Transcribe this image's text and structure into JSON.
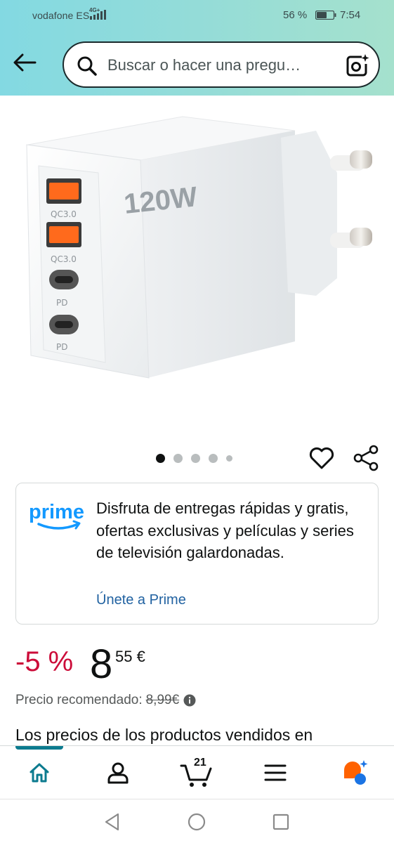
{
  "status_bar": {
    "carrier": "vodafone ES",
    "network_type": "4G+",
    "battery_percent": "56 %",
    "time": "7:54"
  },
  "search": {
    "placeholder": "Buscar o hacer una pregu…",
    "icon": "search-icon",
    "camera_icon": "camera-lens-icon"
  },
  "product": {
    "image_label": "120W",
    "port_labels": [
      "QC3.0",
      "QC3.0",
      "PD",
      "PD"
    ],
    "carousel_total": 5,
    "carousel_active": 1
  },
  "prime": {
    "logo_text": "prime",
    "description": "Disfruta de entregas rápidas y gratis, ofertas exclusivas y películas y series de televisión galardonadas.",
    "join_link": "Únete a Prime"
  },
  "price": {
    "discount": "-5 %",
    "whole": "8",
    "fraction": "55 €",
    "recommended_label": "Precio recomendado:",
    "recommended_value": "8,99€"
  },
  "note": "Los precios de los productos vendidos en",
  "bottom_nav": {
    "cart_count": "21",
    "items": [
      "home",
      "account",
      "cart",
      "menu",
      "rufus"
    ]
  },
  "colors": {
    "header_start": "#83d9e2",
    "header_end": "#a5e1cd",
    "discount": "#cc0c39",
    "link": "#2162a1",
    "prime_blue": "#1399ff",
    "active_nav": "#0c7b8f",
    "rufus_orange": "#ff6200",
    "rufus_blue": "#1b74e4"
  }
}
